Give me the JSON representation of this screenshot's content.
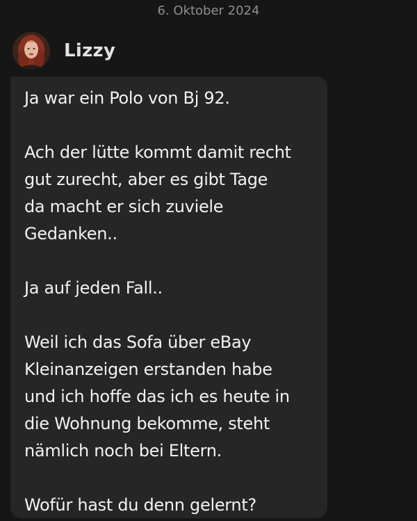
{
  "date_separator": "6. Oktober 2024",
  "sender": {
    "name": "Lizzy",
    "avatar_icon": "profile-photo"
  },
  "message": {
    "text": "Ja war ein Polo von Bj 92.\n\nAch der lütte kommt damit recht\ngut zurecht, aber es gibt Tage\nda macht er sich zuviele\nGedanken..\n\nJa auf jeden Fall..\n\nWeil ich das Sofa über eBay\nKleinanzeigen erstanden habe\nund ich hoffe das ich es heute in\ndie Wohnung bekomme, steht\nnämlich noch bei Eltern.\n\nWofür hast du denn gelernt?"
  },
  "colors": {
    "background": "#161616",
    "bubble": "#262626",
    "text": "#f2f2f2",
    "muted": "#8e8e8e"
  }
}
